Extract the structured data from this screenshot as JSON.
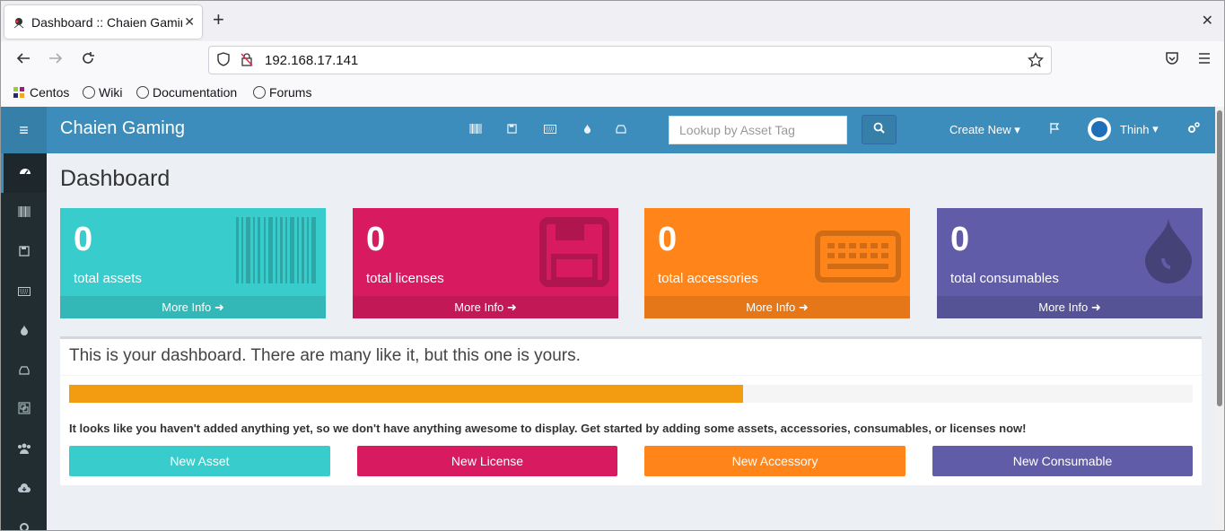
{
  "browser": {
    "tab_title": "Dashboard :: Chaien Gaming",
    "url": "192.168.17.141",
    "bookmarks": [
      "Centos",
      "Wiki",
      "Documentation",
      "Forums"
    ]
  },
  "app": {
    "brand": "Chaien Gaming",
    "search_placeholder": "Lookup by Asset Tag",
    "create_new": "Create New",
    "username": "Thinh",
    "page_title": "Dashboard"
  },
  "stats": [
    {
      "count": "0",
      "label": "total assets",
      "more": "More Info",
      "color": "#39cccc"
    },
    {
      "count": "0",
      "label": "total licenses",
      "more": "More Info",
      "color": "#d81b60"
    },
    {
      "count": "0",
      "label": "total accessories",
      "more": "More Info",
      "color": "#ff851b"
    },
    {
      "count": "0",
      "label": "total consumables",
      "more": "More Info",
      "color": "#605ca8"
    }
  ],
  "panel": {
    "title": "This is your dashboard. There are many like it, but this one is yours.",
    "progress": 0.6,
    "message": "It looks like you haven't added anything yet, so we don't have anything awesome to display. Get started by adding some assets, accessories, consumables, or licenses now!",
    "buttons": [
      "New Asset",
      "New License",
      "New Accessory",
      "New Consumable"
    ]
  }
}
